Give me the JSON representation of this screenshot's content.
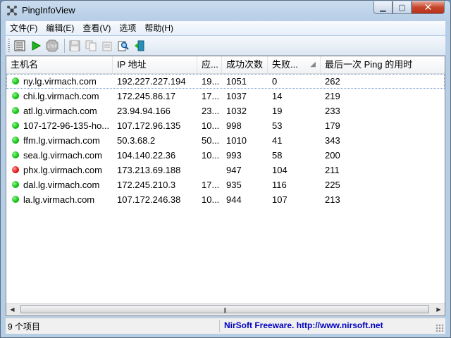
{
  "window": {
    "title": "PingInfoView"
  },
  "menu": [
    "文件(F)",
    "编辑(E)",
    "查看(V)",
    "选项",
    "帮助(H)"
  ],
  "columns": [
    "主机名",
    "IP 地址",
    "应...",
    "成功次数",
    "失败...",
    "最后一次 Ping 的用时"
  ],
  "rows": [
    {
      "status": "green",
      "host": "ny.lg.virmach.com",
      "ip": "192.227.227.194",
      "resp": "19...",
      "success": "1051",
      "fail": "0",
      "last": "262"
    },
    {
      "status": "green",
      "host": "chi.lg.virmach.com",
      "ip": "172.245.86.17",
      "resp": "17...",
      "success": "1037",
      "fail": "14",
      "last": "219"
    },
    {
      "status": "green",
      "host": "atl.lg.virmach.com",
      "ip": "23.94.94.166",
      "resp": "23...",
      "success": "1032",
      "fail": "19",
      "last": "233"
    },
    {
      "status": "green",
      "host": "107-172-96-135-ho...",
      "ip": "107.172.96.135",
      "resp": "10...",
      "success": "998",
      "fail": "53",
      "last": "179"
    },
    {
      "status": "green",
      "host": "ffm.lg.virmach.com",
      "ip": "50.3.68.2",
      "resp": "50...",
      "success": "1010",
      "fail": "41",
      "last": "343"
    },
    {
      "status": "green",
      "host": "sea.lg.virmach.com",
      "ip": "104.140.22.36",
      "resp": "10...",
      "success": "993",
      "fail": "58",
      "last": "200"
    },
    {
      "status": "red",
      "host": "phx.lg.virmach.com",
      "ip": "173.213.69.188",
      "resp": "",
      "success": "947",
      "fail": "104",
      "last": "211"
    },
    {
      "status": "green",
      "host": "dal.lg.virmach.com",
      "ip": "172.245.210.3",
      "resp": "17...",
      "success": "935",
      "fail": "116",
      "last": "225"
    },
    {
      "status": "green",
      "host": "la.lg.virmach.com",
      "ip": "107.172.246.38",
      "resp": "10...",
      "success": "944",
      "fail": "107",
      "last": "213"
    }
  ],
  "status": {
    "count": "9 个项目",
    "credit": "NirSoft Freeware.  http://www.nirsoft.net"
  }
}
